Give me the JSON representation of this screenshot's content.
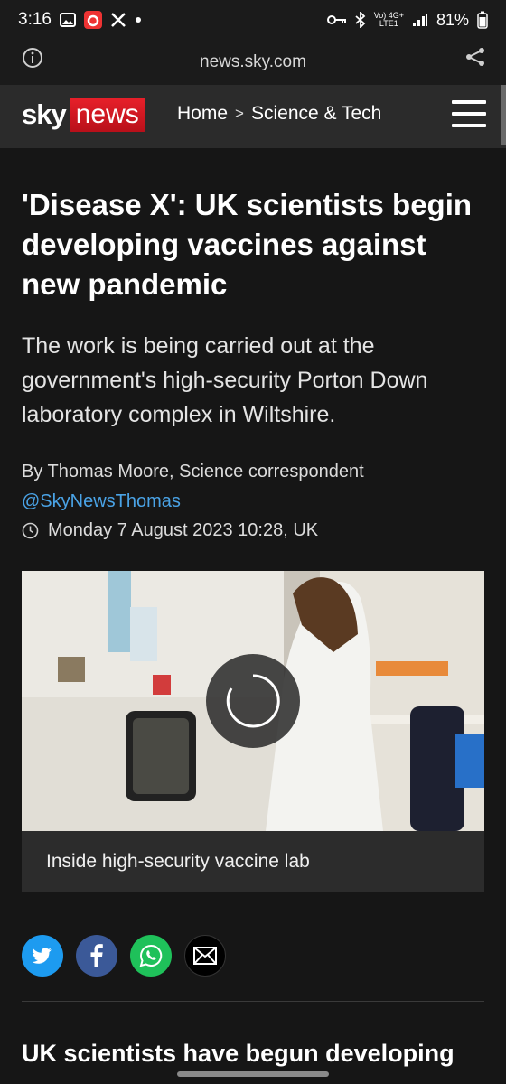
{
  "status_bar": {
    "time": "3:16",
    "network_top": "Vo) 4G+",
    "network_bottom": "LTE1",
    "battery": "81%",
    "icons": [
      "gallery-icon",
      "app-notification-icon",
      "x-icon",
      "dot-icon",
      "key-icon",
      "bluetooth-icon",
      "signal-icon",
      "battery-icon"
    ]
  },
  "browser": {
    "url": "news.sky.com"
  },
  "header": {
    "logo_sky": "sky",
    "logo_news": "news",
    "breadcrumb_home": "Home",
    "breadcrumb_sep": ">",
    "breadcrumb_section": "Science & Tech",
    "brand_color": "#e8202a"
  },
  "article": {
    "headline": "'Disease X': UK scientists begin developing vaccines against new pandemic",
    "standfirst": "The work is being carried out at the government's high-security Porton Down laboratory complex in Wiltshire.",
    "byline": "By Thomas Moore, Science correspondent",
    "twitter_handle": "@SkyNewsThomas",
    "date": "Monday 7 August 2023 10:28, UK",
    "media_caption": "Inside high-security vaccine lab",
    "body_first_line": "UK scientists have begun developing"
  },
  "social": {
    "buttons": [
      "twitter",
      "facebook",
      "whatsapp",
      "email"
    ]
  }
}
